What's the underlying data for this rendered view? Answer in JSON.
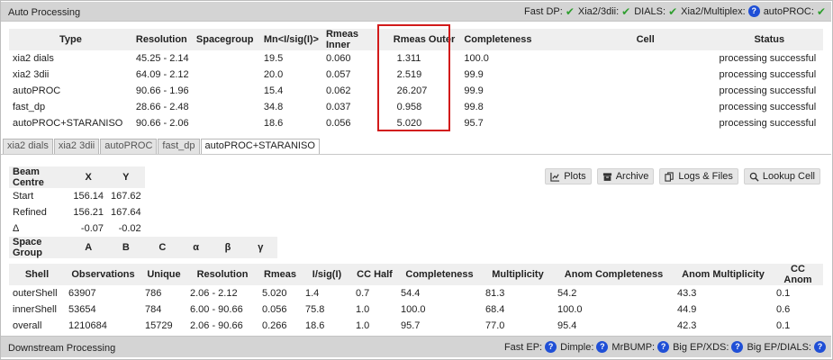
{
  "top_bar": {
    "title": "Auto Processing",
    "statuses": [
      {
        "label": "Fast DP:",
        "icon": "check-icon"
      },
      {
        "label": "Xia2/3dii:",
        "icon": "check-icon"
      },
      {
        "label": "DIALS:",
        "icon": "check-icon"
      },
      {
        "label": "Xia2/Multiplex:",
        "icon": "question-icon"
      },
      {
        "label": "autoPROC:",
        "icon": "check-icon"
      }
    ]
  },
  "summary": {
    "columns": [
      "Type",
      "Resolution",
      "Spacegroup",
      "Mn<I/sig(I)>",
      "Rmeas Inner",
      "Rmeas Outer",
      "Completeness",
      "Cell",
      "Status"
    ],
    "rows": [
      [
        "xia2 dials",
        "45.25 - 2.14",
        "",
        "19.5",
        "0.060",
        "1.311",
        "100.0",
        "",
        "processing successful"
      ],
      [
        "xia2 3dii",
        "64.09 - 2.12",
        "",
        "20.0",
        "0.057",
        "2.519",
        "99.9",
        "",
        "processing successful"
      ],
      [
        "autoPROC",
        "90.66 - 1.96",
        "",
        "15.4",
        "0.062",
        "26.207",
        "99.9",
        "",
        "processing successful"
      ],
      [
        "fast_dp",
        "28.66 - 2.48",
        "",
        "34.8",
        "0.037",
        "0.958",
        "99.8",
        "",
        "processing successful"
      ],
      [
        "autoPROC+STARANISO",
        "90.66 - 2.06",
        "",
        "18.6",
        "0.056",
        "5.020",
        "95.7",
        "",
        "processing successful"
      ]
    ]
  },
  "tabs": [
    "xia2 dials",
    "xia2 3dii",
    "autoPROC",
    "fast_dp",
    "autoPROC+STARANISO"
  ],
  "active_tab": "autoPROC+STARANISO",
  "beam": {
    "headers": [
      "Beam Centre",
      "X",
      "Y"
    ],
    "rows": [
      [
        "Start",
        "156.14",
        "167.62"
      ],
      [
        "Refined",
        "156.21",
        "167.64"
      ],
      [
        "Δ",
        "-0.07",
        "-0.02"
      ]
    ],
    "sg_headers": [
      "Space Group",
      "A",
      "B",
      "C",
      "α",
      "β",
      "γ"
    ]
  },
  "buttons": [
    {
      "label": "Plots",
      "icon": "chart-icon"
    },
    {
      "label": "Archive",
      "icon": "archive-icon"
    },
    {
      "label": "Logs & Files",
      "icon": "files-icon"
    },
    {
      "label": "Lookup Cell",
      "icon": "search-icon"
    }
  ],
  "shells": {
    "columns": [
      "Shell",
      "Observations",
      "Unique",
      "Resolution",
      "Rmeas",
      "I/sig(I)",
      "CC Half",
      "Completeness",
      "Multiplicity",
      "Anom Completeness",
      "Anom Multiplicity",
      "CC Anom"
    ],
    "rows": [
      [
        "outerShell",
        "63907",
        "786",
        "2.06 - 2.12",
        "5.020",
        "1.4",
        "0.7",
        "54.4",
        "81.3",
        "54.2",
        "43.3",
        "0.1"
      ],
      [
        "innerShell",
        "53654",
        "784",
        "6.00 - 90.66",
        "0.056",
        "75.8",
        "1.0",
        "100.0",
        "68.4",
        "100.0",
        "44.9",
        "0.6"
      ],
      [
        "overall",
        "1210684",
        "15729",
        "2.06 - 90.66",
        "0.266",
        "18.6",
        "1.0",
        "95.7",
        "77.0",
        "95.4",
        "42.3",
        "0.1"
      ]
    ]
  },
  "bottom_bar": {
    "title": "Downstream Processing",
    "statuses": [
      {
        "label": "Fast EP:",
        "icon": "question-icon"
      },
      {
        "label": "Dimple:",
        "icon": "question-icon"
      },
      {
        "label": "MrBUMP:",
        "icon": "question-icon"
      },
      {
        "label": "Big EP/XDS:",
        "icon": "question-icon"
      },
      {
        "label": "Big EP/DIALS:",
        "icon": "question-icon"
      }
    ]
  },
  "colors": {
    "check": "#2e9e2e",
    "question": "#1f4fd6",
    "highlight": "#d21a1a"
  }
}
